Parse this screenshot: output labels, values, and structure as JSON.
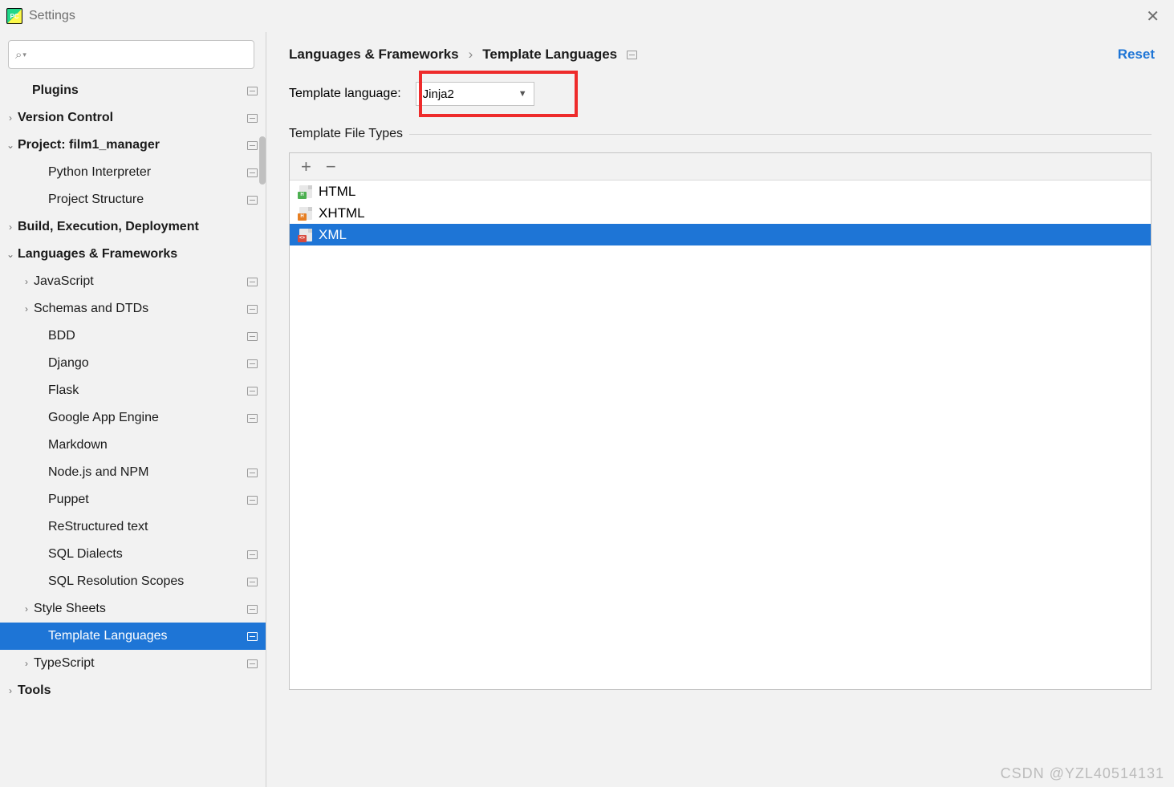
{
  "window": {
    "title": "Settings"
  },
  "search": {
    "value": ""
  },
  "tree": [
    {
      "label": "Plugins",
      "bold": true,
      "indent": 40,
      "arrow": "",
      "badge": true
    },
    {
      "label": "Version Control",
      "bold": true,
      "indent": 22,
      "arrow": "›",
      "badge": true
    },
    {
      "label": "Project: film1_manager",
      "bold": true,
      "indent": 22,
      "arrow": "⌄",
      "badge": true
    },
    {
      "label": "Python Interpreter",
      "bold": false,
      "indent": 60,
      "arrow": "",
      "badge": true
    },
    {
      "label": "Project Structure",
      "bold": false,
      "indent": 60,
      "arrow": "",
      "badge": true
    },
    {
      "label": "Build, Execution, Deployment",
      "bold": true,
      "indent": 22,
      "arrow": "›",
      "badge": false
    },
    {
      "label": "Languages & Frameworks",
      "bold": true,
      "indent": 22,
      "arrow": "⌄",
      "badge": false
    },
    {
      "label": "JavaScript",
      "bold": false,
      "indent": 42,
      "arrow": "›",
      "badge": true
    },
    {
      "label": "Schemas and DTDs",
      "bold": false,
      "indent": 42,
      "arrow": "›",
      "badge": true
    },
    {
      "label": "BDD",
      "bold": false,
      "indent": 60,
      "arrow": "",
      "badge": true
    },
    {
      "label": "Django",
      "bold": false,
      "indent": 60,
      "arrow": "",
      "badge": true
    },
    {
      "label": "Flask",
      "bold": false,
      "indent": 60,
      "arrow": "",
      "badge": true
    },
    {
      "label": "Google App Engine",
      "bold": false,
      "indent": 60,
      "arrow": "",
      "badge": true
    },
    {
      "label": "Markdown",
      "bold": false,
      "indent": 60,
      "arrow": "",
      "badge": false
    },
    {
      "label": "Node.js and NPM",
      "bold": false,
      "indent": 60,
      "arrow": "",
      "badge": true
    },
    {
      "label": "Puppet",
      "bold": false,
      "indent": 60,
      "arrow": "",
      "badge": true
    },
    {
      "label": "ReStructured text",
      "bold": false,
      "indent": 60,
      "arrow": "",
      "badge": false
    },
    {
      "label": "SQL Dialects",
      "bold": false,
      "indent": 60,
      "arrow": "",
      "badge": true
    },
    {
      "label": "SQL Resolution Scopes",
      "bold": false,
      "indent": 60,
      "arrow": "",
      "badge": true
    },
    {
      "label": "Style Sheets",
      "bold": false,
      "indent": 42,
      "arrow": "›",
      "badge": true
    },
    {
      "label": "Template Languages",
      "bold": false,
      "indent": 60,
      "arrow": "",
      "badge": true,
      "selected": true
    },
    {
      "label": "TypeScript",
      "bold": false,
      "indent": 42,
      "arrow": "›",
      "badge": true
    },
    {
      "label": "Tools",
      "bold": true,
      "indent": 22,
      "arrow": "›",
      "badge": false
    }
  ],
  "breadcrumb": {
    "a": "Languages & Frameworks",
    "b": "Template Languages"
  },
  "reset": "Reset",
  "template_lang": {
    "label": "Template language:",
    "value": "Jinja2"
  },
  "section": "Template File Types",
  "filetypes": [
    {
      "label": "HTML",
      "color": "green",
      "tag": "H",
      "selected": false
    },
    {
      "label": "XHTML",
      "color": "orange",
      "tag": "H",
      "selected": false
    },
    {
      "label": "XML",
      "color": "red",
      "tag": "<>",
      "selected": true
    }
  ],
  "watermark": "CSDN @YZL40514131"
}
